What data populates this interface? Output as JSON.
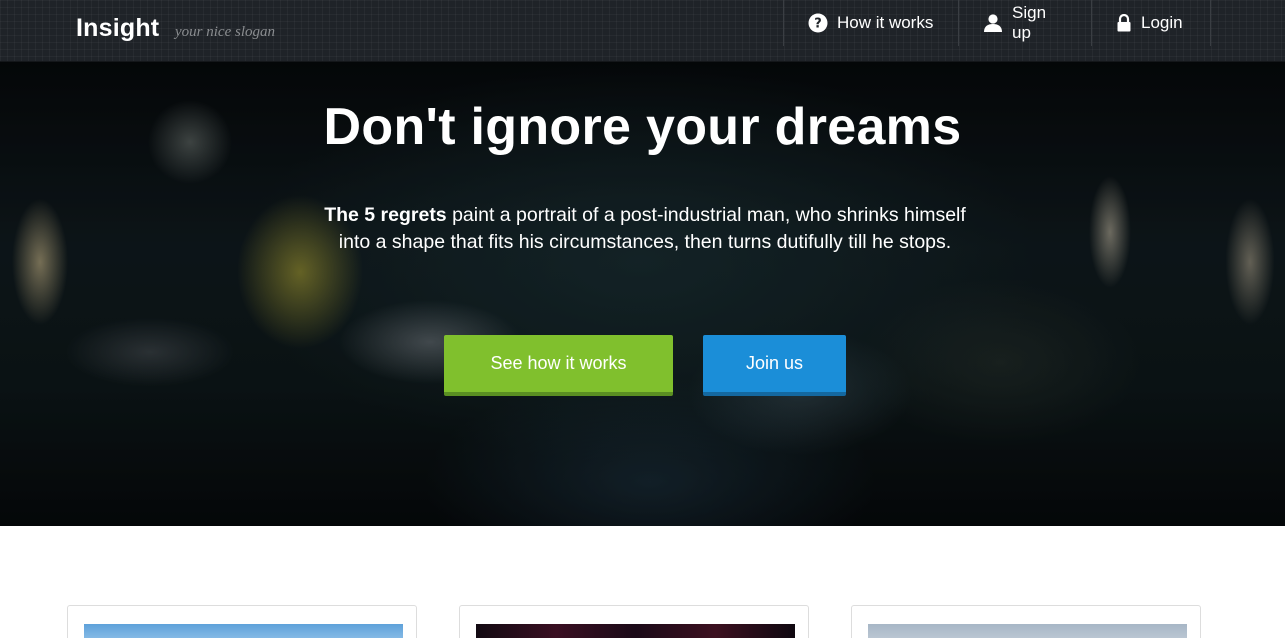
{
  "navbar": {
    "brand": "Insight",
    "slogan": "your nice slogan",
    "items": [
      {
        "label": "How it works",
        "icon": "question-circle-icon"
      },
      {
        "label": "Sign up",
        "icon": "user-icon"
      },
      {
        "label": "Login",
        "icon": "lock-icon"
      }
    ]
  },
  "hero": {
    "title": "Don't ignore your dreams",
    "text_bold": "The 5 regrets",
    "text_rest": " paint a portrait of a post-industrial man, who shrinks himself into a shape that fits his circumstances, then turns dutifully till he stops.",
    "primary_button": "See how it works",
    "secondary_button": "Join us"
  },
  "colors": {
    "primary_button": "#80c02d",
    "secondary_button": "#1b8ed8",
    "navbar": "#1f2328"
  }
}
